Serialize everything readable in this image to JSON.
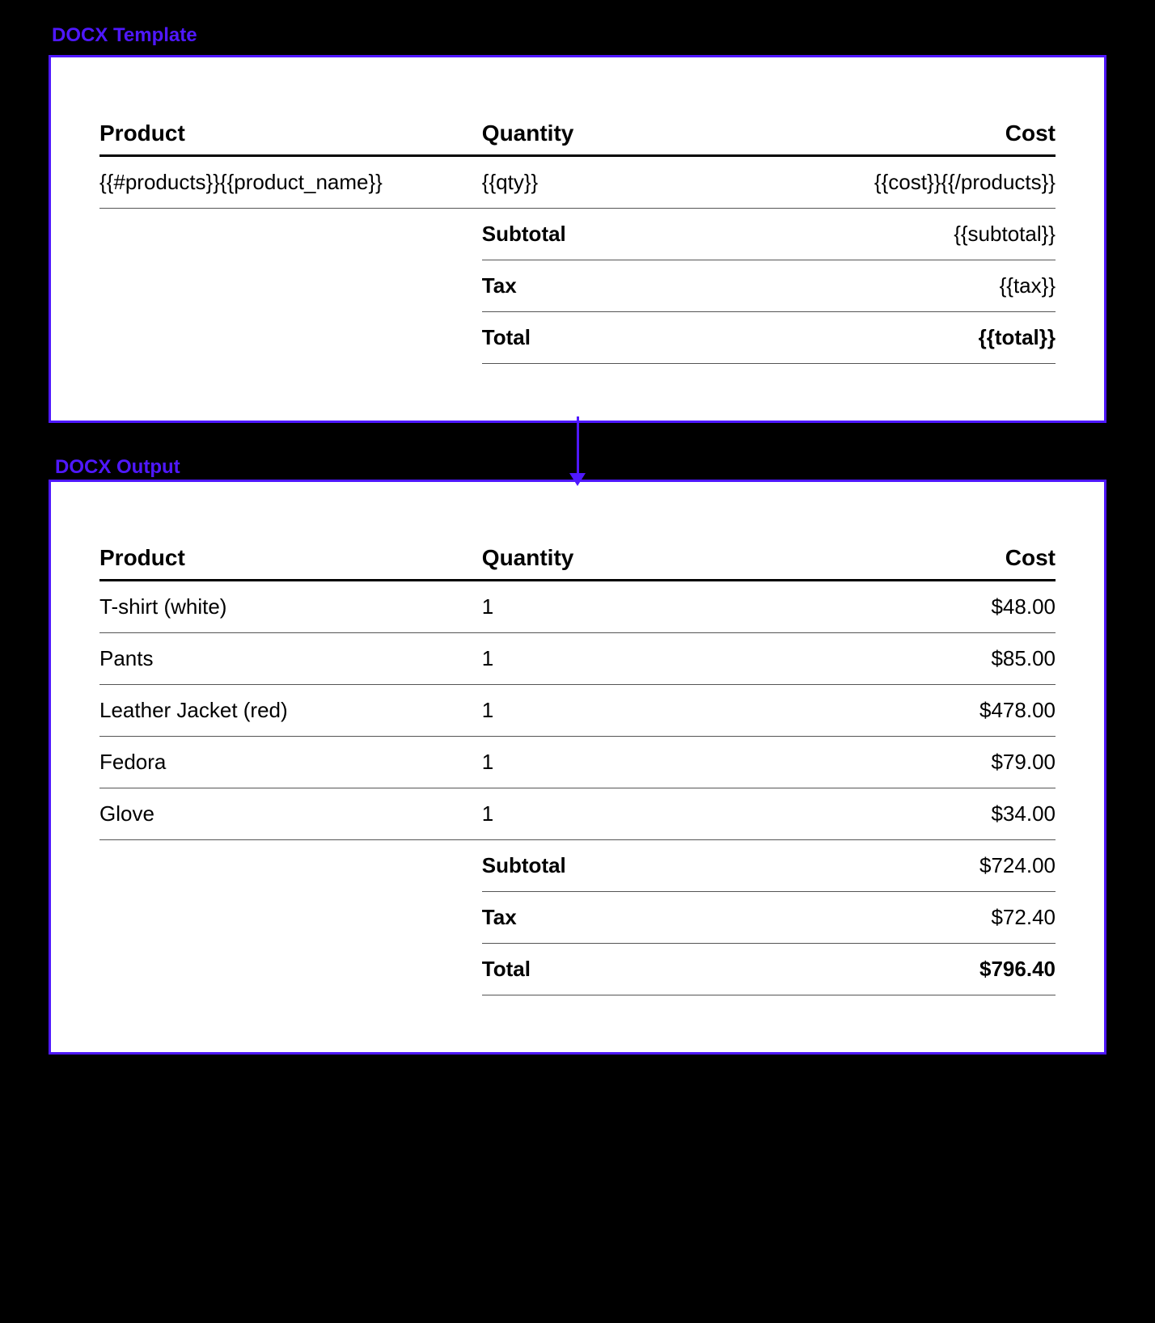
{
  "labels": {
    "template_section": "DOCX Template",
    "output_section": "DOCX Output"
  },
  "template": {
    "headers": {
      "product": "Product",
      "quantity": "Quantity",
      "cost": "Cost"
    },
    "row": {
      "product": "{{#products}}{{product_name}}",
      "quantity": "{{qty}}",
      "cost": "{{cost}}{{/products}}"
    },
    "summary": {
      "subtotal_label": "Subtotal",
      "subtotal_value": "{{subtotal}}",
      "tax_label": "Tax",
      "tax_value": "{{tax}}",
      "total_label": "Total",
      "total_value": "{{total}}"
    }
  },
  "output": {
    "headers": {
      "product": "Product",
      "quantity": "Quantity",
      "cost": "Cost"
    },
    "rows": [
      {
        "product": "T-shirt (white)",
        "quantity": "1",
        "cost": "$48.00"
      },
      {
        "product": "Pants",
        "quantity": "1",
        "cost": "$85.00"
      },
      {
        "product": "Leather Jacket (red)",
        "quantity": "1",
        "cost": "$478.00"
      },
      {
        "product": "Fedora",
        "quantity": "1",
        "cost": "$79.00"
      },
      {
        "product": "Glove",
        "quantity": "1",
        "cost": "$34.00"
      }
    ],
    "summary": {
      "subtotal_label": "Subtotal",
      "subtotal_value": "$724.00",
      "tax_label": "Tax",
      "tax_value": "$72.40",
      "total_label": "Total",
      "total_value": "$796.40"
    }
  }
}
